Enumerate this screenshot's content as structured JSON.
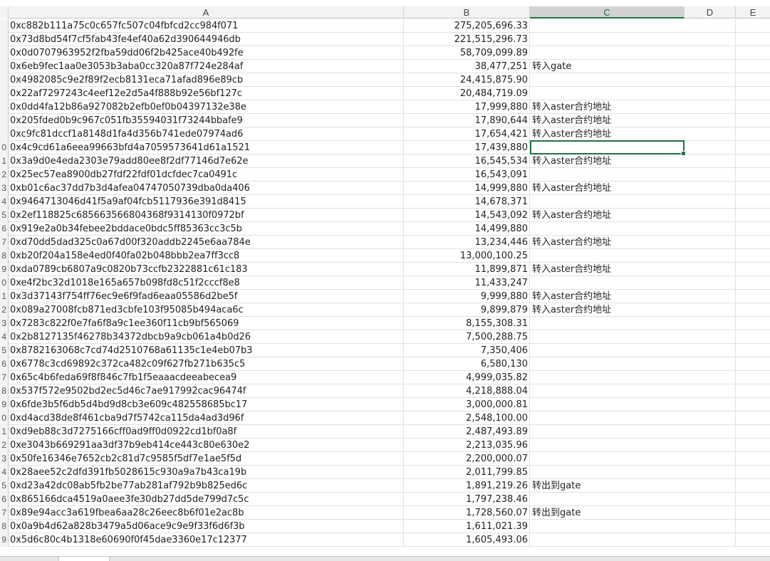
{
  "columns": [
    "A",
    "B",
    "C",
    "D",
    "E"
  ],
  "row_numbers": [
    "",
    "",
    "",
    "",
    "",
    "",
    "",
    "",
    "",
    "0",
    "1",
    "2",
    "3",
    "4",
    "5",
    "6",
    "7",
    "8",
    "9",
    "0",
    "1",
    "2",
    "3",
    "4",
    "5",
    "6",
    "7",
    "8",
    "9",
    "0",
    "1",
    "2",
    "3",
    "4",
    "5",
    "6",
    "7",
    "8",
    "9",
    "0"
  ],
  "rows": [
    {
      "a": "0xc882b111a75c0c657fc507c04fbfcd2cc984f071",
      "b": "275,205,696.33",
      "c": ""
    },
    {
      "a": "0x73d8bd54f7cf5fab43fe4ef40a62d390644946db",
      "b": "221,515,296.73",
      "c": ""
    },
    {
      "a": "0x0d0707963952f2fba59dd06f2b425ace40b492fe",
      "b": "58,709,099.89",
      "c": ""
    },
    {
      "a": "0x6eb9fec1aa0e3053b3aba0cc320a87f724e284af",
      "b": "38,477,251",
      "c": "转入gate"
    },
    {
      "a": "0x4982085c9e2f89f2ecb8131eca71afad896e89cb",
      "b": "24,415,875.90",
      "c": ""
    },
    {
      "a": "0x22af7297243c4eef12e2d5a4f888b92e56bf127c",
      "b": "20,484,719.09",
      "c": ""
    },
    {
      "a": "0x0dd4fa12b86a927082b2efb0ef0b04397132e38e",
      "b": "17,999,880",
      "c": "转入aster合约地址"
    },
    {
      "a": "0x205fded0b9c967c051fb35594031f73244bbafe9",
      "b": "17,890,644",
      "c": "转入aster合约地址"
    },
    {
      "a": "0xc9fc81dccf1a8148d1fa4d356b741ede07974ad6",
      "b": "17,654,421",
      "c": "转入aster合约地址"
    },
    {
      "a": "0x4c9cd61a6eea99663bfd4a7059573641d61a1521",
      "b": "17,439,880",
      "c": ""
    },
    {
      "a": "0x3a9d0e4eda2303e79add80ee8f2df77146d7e62e",
      "b": "16,545,534",
      "c": "转入aster合约地址"
    },
    {
      "a": "0x25ec57ea8900db27fdf22fdf01dcfdec7ca0491c",
      "b": "16,543,091",
      "c": ""
    },
    {
      "a": "0xb01c6ac37dd7b3d4afea04747050739dba0da406",
      "b": "14,999,880",
      "c": "转入aster合约地址"
    },
    {
      "a": "0x9464713046d41f5a9af04fcb5117936e391d8415",
      "b": "14,678,371",
      "c": ""
    },
    {
      "a": "0x2ef118825c685663566804368f9314130f0972bf",
      "b": "14,543,092",
      "c": "转入aster合约地址"
    },
    {
      "a": "0x919e2a0b34febee2bddace0bdc5ff85363cc3c5b",
      "b": "14,499,880",
      "c": ""
    },
    {
      "a": "0xd70dd5dad325c0a67d00f320addb2245e6aa784e",
      "b": "13,234,446",
      "c": "转入aster合约地址"
    },
    {
      "a": "0xb20f204a158e4ed0f40fa02b048bbb2ea7ff3cc8",
      "b": "13,000,100.25",
      "c": ""
    },
    {
      "a": "0xda0789cb6807a9c0820b73ccfb2322881c61c183",
      "b": "11,899,871",
      "c": "转入aster合约地址"
    },
    {
      "a": "0xe4f2bc32d1018e165a657b098fd8c51f2cccf8e8",
      "b": "11,433,247",
      "c": ""
    },
    {
      "a": "0x3d37143f754ff76ec9e6f9fad6eaa05586d2be5f",
      "b": "9,999,880",
      "c": "转入aster合约地址"
    },
    {
      "a": "0x089a27008fcb871ed3cbfe103f95085b494aca6c",
      "b": "9,899,879",
      "c": "转入aster合约地址"
    },
    {
      "a": "0x7283c822f0e7fa6f8a9c1ee360f11cb9bf565069",
      "b": "8,155,308.31",
      "c": ""
    },
    {
      "a": "0x2b8127135f46278b34372dbcb9a9cb061a4b0d26",
      "b": "7,500,288.75",
      "c": ""
    },
    {
      "a": "0x8782163068c7cd74d2510768a61135c1e4eb07b3",
      "b": "7,350,406",
      "c": ""
    },
    {
      "a": "0x6778c3cd69892c372ca482c09f627fb271b635c5",
      "b": "6,580,130",
      "c": ""
    },
    {
      "a": "0x65c4b6feda69f8f846c7fb1f5eaaacdeeabecea9",
      "b": "4,999,035.82",
      "c": ""
    },
    {
      "a": "0x537f572e9502bd2ec5d46c7ae917992cac96474f",
      "b": "4,218,888.04",
      "c": ""
    },
    {
      "a": "0x6fde3b5f6db5d4bd9d8cb3e609c482558685bc17",
      "b": "3,000,000.81",
      "c": ""
    },
    {
      "a": "0xd4acd38de8f461cba9d7f5742ca115da4ad3d96f",
      "b": "2,548,100.00",
      "c": ""
    },
    {
      "a": "0xd9eb88c3d7275166cff0ad9ff0d0922cd1bf0a8f",
      "b": "2,487,493.89",
      "c": ""
    },
    {
      "a": "0xe3043b669291aa3df37b9eb414ce443c80e630e2",
      "b": "2,213,035.96",
      "c": ""
    },
    {
      "a": "0x50fe16346e7652cb2c81d7c9585f5df7e1ae5f5d",
      "b": "2,200,000.07",
      "c": ""
    },
    {
      "a": "0x28aee52c2dfd391fb5028615c930a9a7b43ca19b",
      "b": "2,011,799.85",
      "c": ""
    },
    {
      "a": "0xd23a42dc08ab5fb2be77ab281af792b9b825ed6c",
      "b": "1,891,219.26",
      "c": "转出到gate"
    },
    {
      "a": "0x865166dca4519a0aee3fe30db27dd5de799d7c5c",
      "b": "1,797,238.46",
      "c": ""
    },
    {
      "a": "0x89e94acc3a619fbea6aa28c26eec8b6f01e2ac8b",
      "b": "1,728,560.07",
      "c": "转出到gate"
    },
    {
      "a": "0x0a9b4d62a828b3479a5d06ace9c9e9f33f6d6f3b",
      "b": "1,611,021.39",
      "c": ""
    },
    {
      "a": "0x5d6c80c4b1318e60690f0f45dae3360e17c12377",
      "b": "1,605,493.06",
      "c": ""
    }
  ],
  "colors": {
    "accent": "#217346",
    "header_bg": "#f3f3f3",
    "gridline": "#e1e1e1"
  }
}
